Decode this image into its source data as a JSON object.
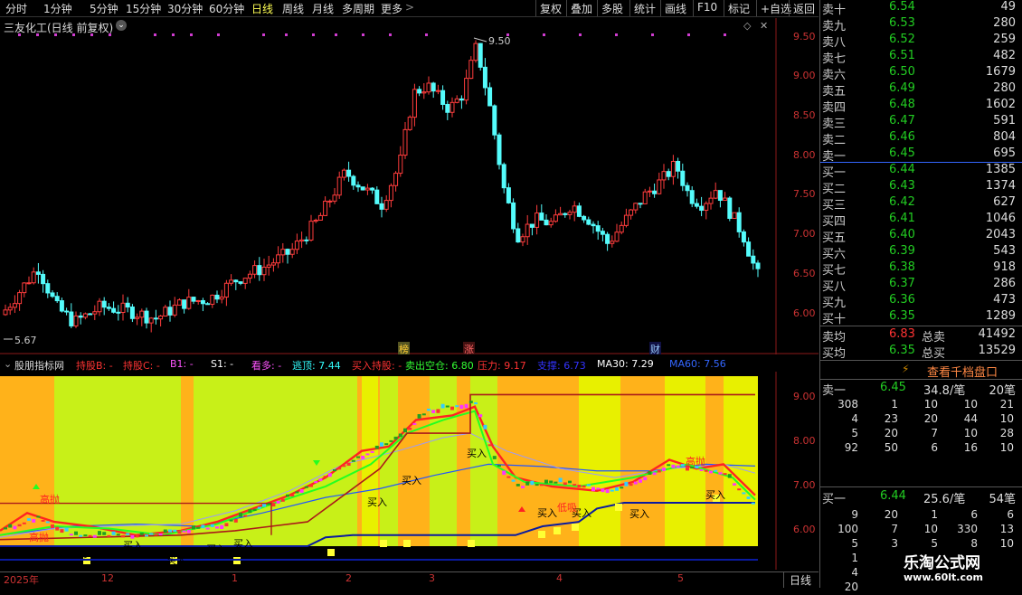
{
  "toolbar": {
    "periods": [
      "分时",
      "1分钟",
      "5分钟",
      "15分钟",
      "30分钟",
      "60分钟",
      "日线",
      "周线",
      "月线",
      "多周期",
      "更多"
    ],
    "active": "日线",
    "more_arrow": ">",
    "right_buttons": [
      "复权",
      "叠加",
      "多股",
      "统计",
      "画线",
      "F10",
      "标记",
      "+自选",
      "返回"
    ]
  },
  "main_chart": {
    "title": "三友化工(日线 前复权)",
    "high_label": "9.50",
    "low_label": "5.67",
    "price_ticks": [
      "9.50",
      "9.00",
      "8.50",
      "8.00",
      "7.50",
      "7.00",
      "6.50",
      "6.00"
    ],
    "event_tags": [
      "榜",
      "涨",
      "财"
    ]
  },
  "indicator": {
    "name": "股朋指标网",
    "legend": [
      {
        "text": "持股B: -",
        "color": "#ff3333"
      },
      {
        "text": "持股C: -",
        "color": "#ff3333"
      },
      {
        "text": "B1: -",
        "color": "#ff55ff"
      },
      {
        "text": "S1: -",
        "color": "#ffffff"
      },
      {
        "text": "看多: -",
        "color": "#ff55ff"
      },
      {
        "text": "逃顶: 7.44",
        "color": "#33ffff"
      },
      {
        "text": "买入持股: -",
        "color": "#ff3333"
      },
      {
        "text": "卖出空仓: 6.80",
        "color": "#33ff33"
      },
      {
        "text": "压力: 9.17",
        "color": "#ff3333"
      },
      {
        "text": "支撑: 6.73",
        "color": "#3333ff"
      },
      {
        "text": "MA30: 7.29",
        "color": "#ffffff"
      },
      {
        "text": "MA60: 7.56",
        "color": "#3366ff"
      }
    ],
    "ticks": [
      "9.00",
      "8.00",
      "7.00",
      "6.00"
    ],
    "annotations": [
      "高抛",
      "高抛",
      "高抛",
      "买入",
      "买入",
      "买入",
      "买入",
      "买入",
      "买入",
      "买入",
      "买入",
      "买入",
      "买入",
      "买入",
      "买入",
      "低吸"
    ]
  },
  "bottom_axis": {
    "labels": [
      "2025年",
      "12",
      "1",
      "2",
      "3",
      "4",
      "5"
    ],
    "period": "日线"
  },
  "order_book": {
    "asks": [
      {
        "label": "卖十",
        "price": "6.54",
        "vol": "49"
      },
      {
        "label": "卖九",
        "price": "6.53",
        "vol": "280"
      },
      {
        "label": "卖八",
        "price": "6.52",
        "vol": "259"
      },
      {
        "label": "卖七",
        "price": "6.51",
        "vol": "482"
      },
      {
        "label": "卖六",
        "price": "6.50",
        "vol": "1679"
      },
      {
        "label": "卖五",
        "price": "6.49",
        "vol": "280"
      },
      {
        "label": "卖四",
        "price": "6.48",
        "vol": "1602"
      },
      {
        "label": "卖三",
        "price": "6.47",
        "vol": "591"
      },
      {
        "label": "卖二",
        "price": "6.46",
        "vol": "804"
      },
      {
        "label": "卖一",
        "price": "6.45",
        "vol": "695"
      }
    ],
    "bids": [
      {
        "label": "买一",
        "price": "6.44",
        "vol": "1385"
      },
      {
        "label": "买二",
        "price": "6.43",
        "vol": "1374"
      },
      {
        "label": "买三",
        "price": "6.42",
        "vol": "627"
      },
      {
        "label": "买四",
        "price": "6.41",
        "vol": "1046"
      },
      {
        "label": "买五",
        "price": "6.40",
        "vol": "2043"
      },
      {
        "label": "买六",
        "price": "6.39",
        "vol": "543"
      },
      {
        "label": "买七",
        "price": "6.38",
        "vol": "918"
      },
      {
        "label": "买八",
        "price": "6.37",
        "vol": "286"
      },
      {
        "label": "买九",
        "price": "6.36",
        "vol": "473"
      },
      {
        "label": "买十",
        "price": "6.35",
        "vol": "1289"
      }
    ],
    "avg_ask": {
      "label": "卖均",
      "price": "6.83",
      "total_label": "总卖",
      "total": "41492"
    },
    "avg_bid": {
      "label": "买均",
      "price": "6.35",
      "total_label": "总买",
      "total": "13529"
    },
    "lightning": "⚡",
    "view_thousand": "查看千档盘口",
    "sell_one": {
      "label": "卖一",
      "price": "6.45",
      "per": "34.8/笔",
      "count": "20笔"
    },
    "sell_grid": [
      [
        "308",
        "1",
        "10",
        "10",
        "21"
      ],
      [
        "4",
        "23",
        "20",
        "44",
        "10"
      ],
      [
        "5",
        "20",
        "7",
        "10",
        "28"
      ],
      [
        "92",
        "50",
        "6",
        "16",
        "10"
      ]
    ],
    "buy_one": {
      "label": "买一",
      "price": "6.44",
      "per": "25.6/笔",
      "count": "54笔"
    },
    "buy_grid": [
      [
        "9",
        "20",
        "1",
        "6",
        "6"
      ],
      [
        "100",
        "7",
        "10",
        "330",
        "13"
      ],
      [
        "5",
        "3",
        "5",
        "8",
        "10"
      ],
      [
        "1",
        "",
        "",
        "",
        ""
      ],
      [
        "4",
        "",
        "",
        "",
        ""
      ],
      [
        "20",
        "",
        "",
        "",
        ""
      ]
    ]
  },
  "watermark": {
    "name": "乐淘公式网",
    "url": "www.60lt.com"
  }
}
